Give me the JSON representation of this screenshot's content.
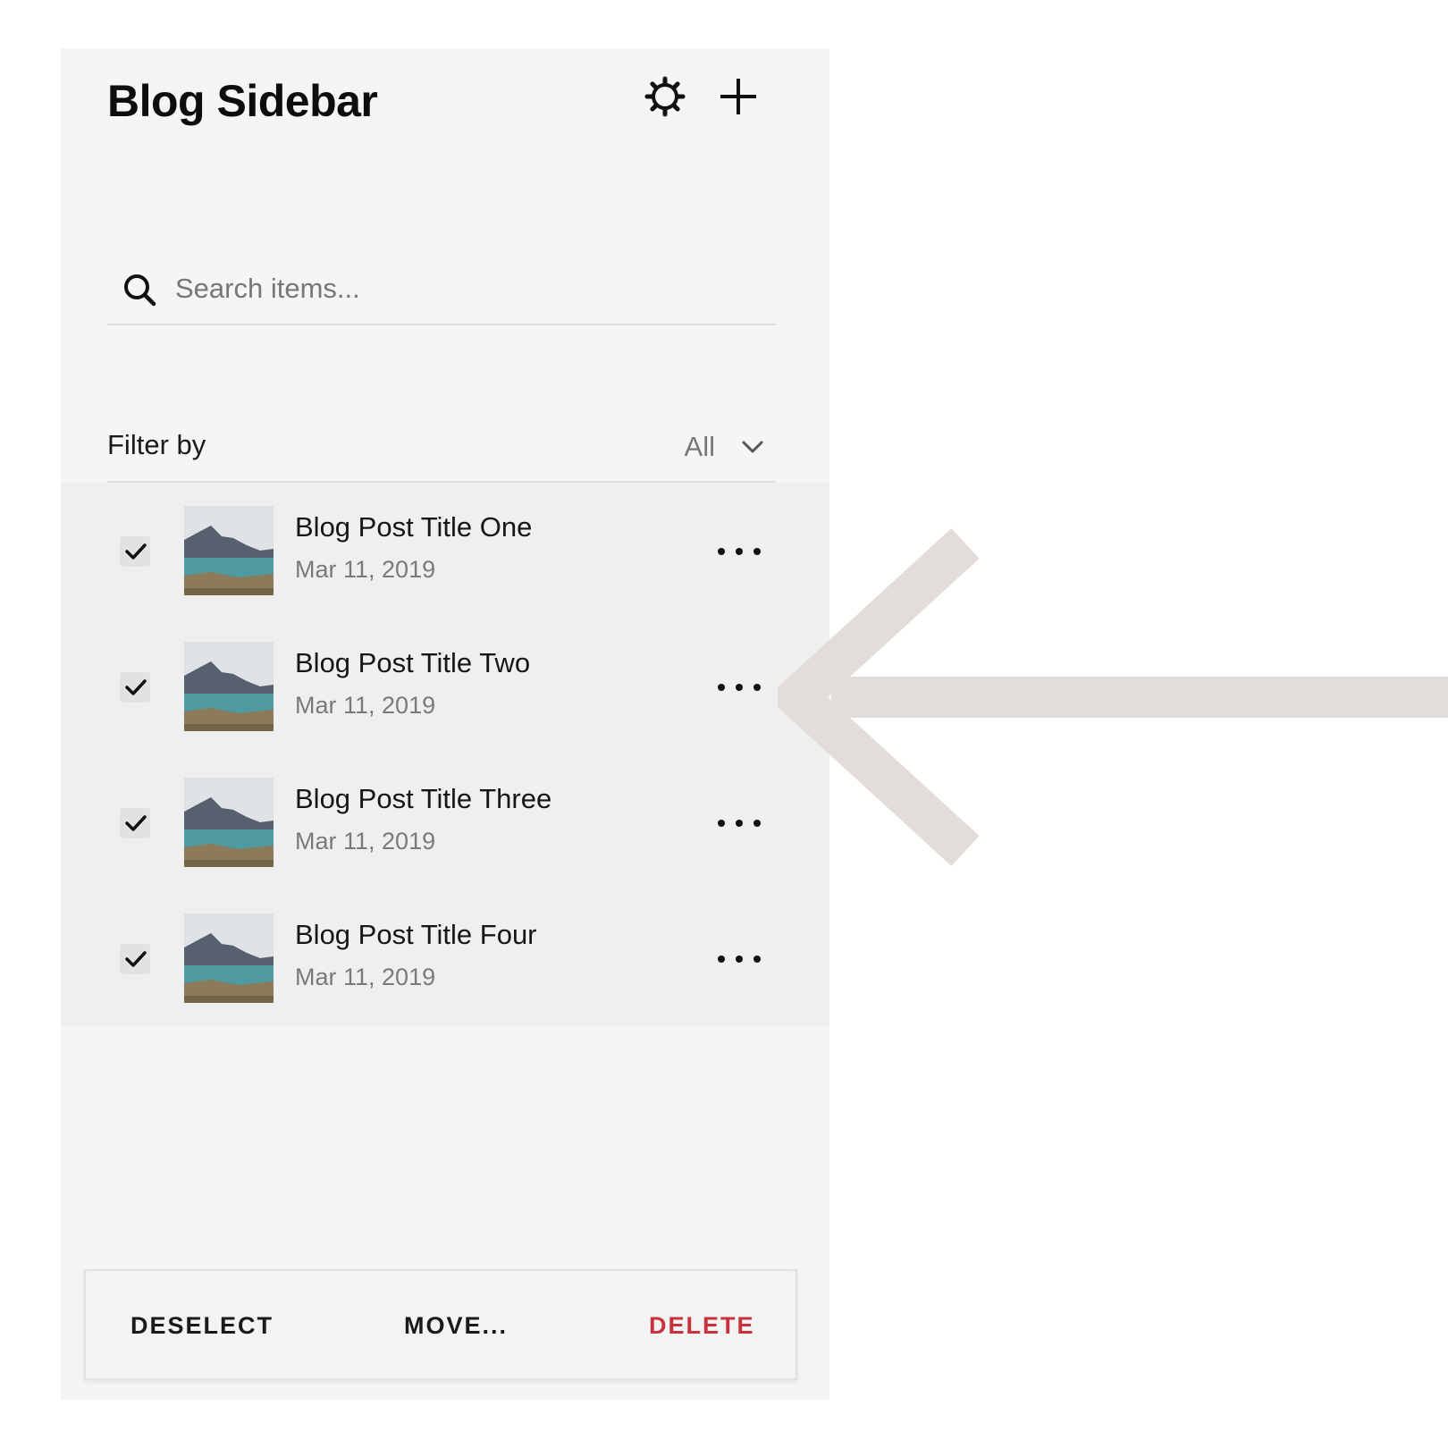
{
  "sidebar": {
    "title": "Blog Sidebar",
    "settings_icon": "gear-icon",
    "add_icon": "plus-icon"
  },
  "search": {
    "placeholder": "Search items...",
    "value": "",
    "icon": "search-icon"
  },
  "filter": {
    "label": "Filter by",
    "selected": "All",
    "icon": "chevron-down-icon"
  },
  "posts": [
    {
      "title": "Blog Post Title One",
      "date": "Mar 11, 2019",
      "checked": true
    },
    {
      "title": "Blog Post Title Two",
      "date": "Mar 11, 2019",
      "checked": true
    },
    {
      "title": "Blog Post Title Three",
      "date": "Mar 11, 2019",
      "checked": true
    },
    {
      "title": "Blog Post Title Four",
      "date": "Mar 11, 2019",
      "checked": true
    }
  ],
  "actions": {
    "deselect": "DESELECT",
    "move": "MOVE...",
    "delete": "DELETE"
  },
  "colors": {
    "panel_bg": "#f5f5f5",
    "selected_rows_bg": "#efefef",
    "delete_red": "#c8323c",
    "arrow": "#e2ddd8"
  }
}
